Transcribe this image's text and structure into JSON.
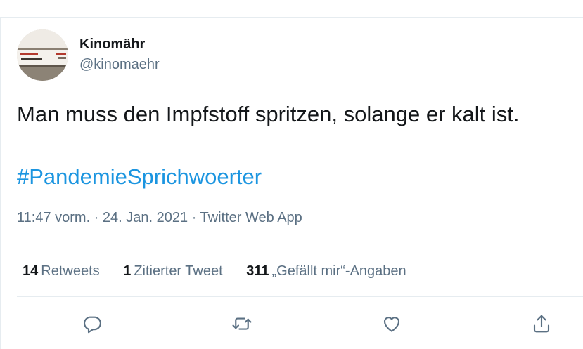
{
  "author": {
    "name": "Kinomähr",
    "handle": "@kinomaehr"
  },
  "tweet": {
    "text": "Man muss den Impfstoff spritzen, solange er kalt ist.",
    "hashtag": "#PandemieSprichwoerter"
  },
  "meta": {
    "time": "11:47 vorm.",
    "separator": "·",
    "date": "24. Jan. 2021",
    "source": "Twitter Web App"
  },
  "stats": {
    "retweets_count": "14",
    "retweets_label": "Retweets",
    "quotes_count": "1",
    "quotes_label": "Zitierter Tweet",
    "likes_count": "311",
    "likes_label": "„Gefällt mir“-Angaben"
  },
  "actions": [
    {
      "name": "reply",
      "icon": "reply-icon"
    },
    {
      "name": "retweet",
      "icon": "retweet-icon"
    },
    {
      "name": "like",
      "icon": "heart-icon"
    },
    {
      "name": "share",
      "icon": "share-icon"
    }
  ],
  "colors": {
    "link": "#1b95e0",
    "secondary_text": "#5b7083",
    "primary_text": "#14171a",
    "divider": "#e6ecf0",
    "icon": "#5b7083"
  }
}
